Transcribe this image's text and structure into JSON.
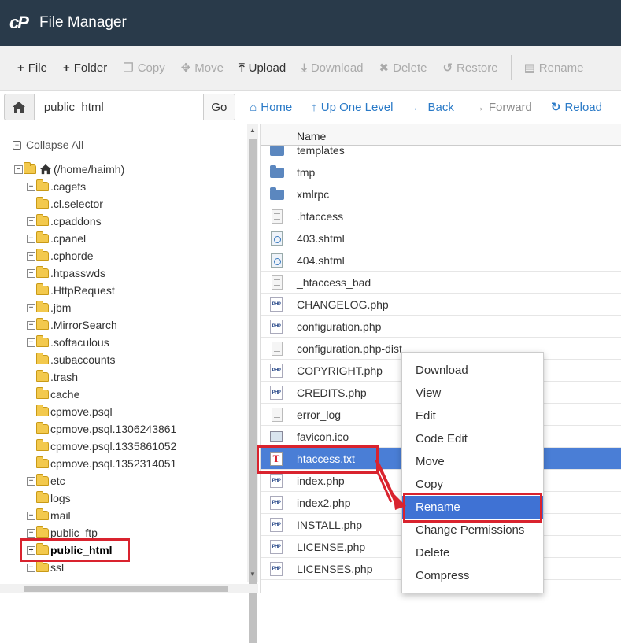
{
  "app": {
    "logo": "cP",
    "title": "File Manager"
  },
  "toolbar": {
    "items": [
      {
        "label": "File",
        "icon": "plus-icon",
        "glyph": "+",
        "enabled": true
      },
      {
        "label": "Folder",
        "icon": "plus-icon",
        "glyph": "+",
        "enabled": true
      },
      {
        "label": "Copy",
        "icon": "copy-icon",
        "glyph": "❐",
        "enabled": false
      },
      {
        "label": "Move",
        "icon": "move-icon",
        "glyph": "✥",
        "enabled": false
      },
      {
        "label": "Upload",
        "icon": "upload-icon",
        "glyph": "⤒",
        "enabled": true
      },
      {
        "label": "Download",
        "icon": "download-icon",
        "glyph": "⤓",
        "enabled": false
      },
      {
        "label": "Delete",
        "icon": "delete-icon",
        "glyph": "✖",
        "enabled": false
      },
      {
        "label": "Restore",
        "icon": "restore-icon",
        "glyph": "↺",
        "enabled": false
      },
      {
        "label": "Rename",
        "icon": "rename-icon",
        "glyph": "▤",
        "enabled": false
      }
    ]
  },
  "pathbar": {
    "path_value": "public_html",
    "go_label": "Go",
    "links": [
      {
        "label": "Home",
        "glyph": "⌂",
        "enabled": true
      },
      {
        "label": "Up One Level",
        "glyph": "↑",
        "enabled": true
      },
      {
        "label": "Back",
        "glyph": "←",
        "enabled": true
      },
      {
        "label": "Forward",
        "glyph": "→",
        "enabled": false
      },
      {
        "label": "Reload",
        "glyph": "↻",
        "enabled": true
      }
    ]
  },
  "tree": {
    "collapse_all_label": "Collapse All",
    "root_label": "(/home/haimh)",
    "items": [
      {
        "label": ".cagefs",
        "expandable": true
      },
      {
        "label": ".cl.selector",
        "expandable": false
      },
      {
        "label": ".cpaddons",
        "expandable": true
      },
      {
        "label": ".cpanel",
        "expandable": true
      },
      {
        "label": ".cphorde",
        "expandable": true
      },
      {
        "label": ".htpasswds",
        "expandable": true
      },
      {
        "label": ".HttpRequest",
        "expandable": false
      },
      {
        "label": ".jbm",
        "expandable": true
      },
      {
        "label": ".MirrorSearch",
        "expandable": true
      },
      {
        "label": ".softaculous",
        "expandable": true
      },
      {
        "label": ".subaccounts",
        "expandable": false
      },
      {
        "label": ".trash",
        "expandable": false
      },
      {
        "label": "cache",
        "expandable": false
      },
      {
        "label": "cpmove.psql",
        "expandable": false
      },
      {
        "label": "cpmove.psql.1306243861",
        "expandable": false
      },
      {
        "label": "cpmove.psql.1335861052",
        "expandable": false
      },
      {
        "label": "cpmove.psql.1352314051",
        "expandable": false
      },
      {
        "label": "etc",
        "expandable": true
      },
      {
        "label": "logs",
        "expandable": false
      },
      {
        "label": "mail",
        "expandable": true
      },
      {
        "label": "public_ftp",
        "expandable": true
      },
      {
        "label": "public_html",
        "expandable": true,
        "current": true
      },
      {
        "label": "ssl",
        "expandable": true
      }
    ]
  },
  "files": {
    "column_name": "Name",
    "rows": [
      {
        "name": "templates",
        "type": "folder"
      },
      {
        "name": "tmp",
        "type": "folder"
      },
      {
        "name": "xmlrpc",
        "type": "folder"
      },
      {
        "name": ".htaccess",
        "type": "doc"
      },
      {
        "name": "403.shtml",
        "type": "shtml"
      },
      {
        "name": "404.shtml",
        "type": "shtml"
      },
      {
        "name": "_htaccess_bad",
        "type": "doc"
      },
      {
        "name": "CHANGELOG.php",
        "type": "php"
      },
      {
        "name": "configuration.php",
        "type": "php"
      },
      {
        "name": "configuration.php-dist",
        "type": "doc"
      },
      {
        "name": "COPYRIGHT.php",
        "type": "php"
      },
      {
        "name": "CREDITS.php",
        "type": "php"
      },
      {
        "name": "error_log",
        "type": "doc"
      },
      {
        "name": "favicon.ico",
        "type": "ico"
      },
      {
        "name": "htaccess.txt",
        "type": "txt",
        "selected": true
      },
      {
        "name": "index.php",
        "type": "php"
      },
      {
        "name": "index2.php",
        "type": "php"
      },
      {
        "name": "INSTALL.php",
        "type": "php"
      },
      {
        "name": "LICENSE.php",
        "type": "php"
      },
      {
        "name": "LICENSES.php",
        "type": "php"
      }
    ]
  },
  "context_menu": {
    "items": [
      {
        "label": "Download"
      },
      {
        "label": "View"
      },
      {
        "label": "Edit"
      },
      {
        "label": "Code Edit"
      },
      {
        "label": "Move"
      },
      {
        "label": "Copy"
      },
      {
        "label": "Rename",
        "active": true
      },
      {
        "label": "Change Permissions"
      },
      {
        "label": "Delete"
      },
      {
        "label": "Compress"
      }
    ]
  },
  "colors": {
    "header_bg": "#293a4a",
    "selected_row": "#4a7ed6",
    "highlight_red": "#d9232e",
    "link_blue": "#2a7ac7"
  }
}
